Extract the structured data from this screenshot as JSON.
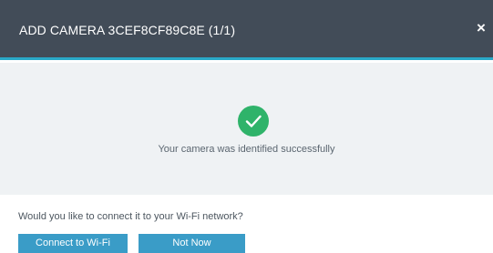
{
  "dialog": {
    "title": "ADD CAMERA 3CEF8CF89C8E (1/1)",
    "close_label": "×",
    "success_message": "Your camera was identified successfully",
    "question": "Would you like to connect it to your Wi-Fi network?",
    "buttons": {
      "connect_label": "Connect to Wi-Fi",
      "not_now_label": "Not Now"
    }
  },
  "icons": {
    "success": "check-circle-icon",
    "close": "close-icon"
  },
  "colors": {
    "header_bg": "#424c58",
    "accent": "#29a9c8",
    "success": "#2fb36a",
    "button": "#3a9cc7"
  }
}
